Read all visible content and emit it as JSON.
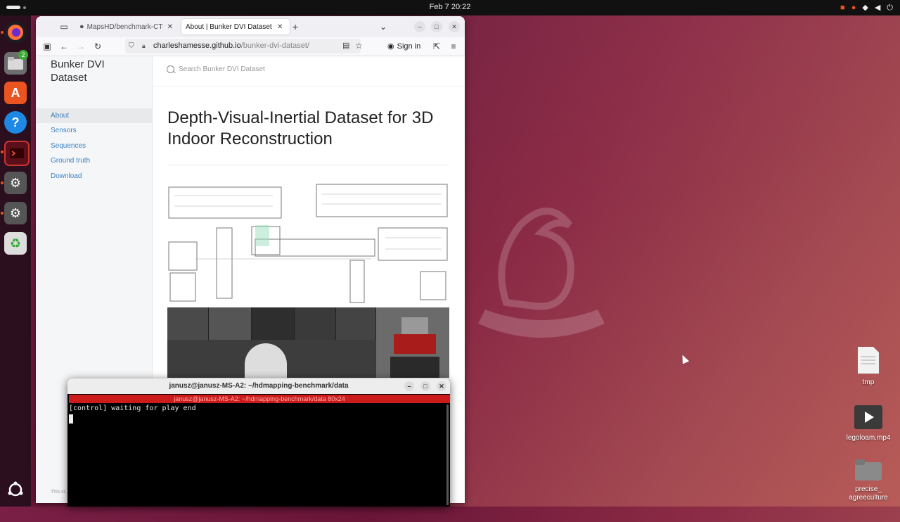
{
  "topbar": {
    "clock": "Feb 7  20:22"
  },
  "dock": {
    "files_badge": "2"
  },
  "browser": {
    "tabs": [
      {
        "label": "MapsHD/benchmark-CT-I",
        "active": false
      },
      {
        "label": "About | Bunker DVI Dataset",
        "active": true
      }
    ],
    "url_host": "charleshamesse.github.io",
    "url_path": "/bunker-dvi-dataset/",
    "signin_label": "Sign in"
  },
  "page": {
    "site_title": "Bunker DVI Dataset",
    "search_placeholder": "Search Bunker DVI Dataset",
    "nav": [
      "About",
      "Sensors",
      "Sequences",
      "Ground truth",
      "Download"
    ],
    "active_nav": "About",
    "heading": "Depth-Visual-Inertial Dataset for 3D Indoor Reconstruction",
    "footer_text": "This si... docum..."
  },
  "terminal": {
    "title": "janusz@janusz-MS-A2: ~/hdmapping-benchmark/data",
    "tab_bar": "janusz@janusz-MS-A2: ~/hdmapping-benchmark/data 80x24",
    "line1": "[control] waiting for play end"
  },
  "desktop": {
    "icons": [
      {
        "label": "tmp"
      },
      {
        "label": "legoloam.mp4"
      },
      {
        "label": "precise_ agreeculture"
      }
    ]
  }
}
